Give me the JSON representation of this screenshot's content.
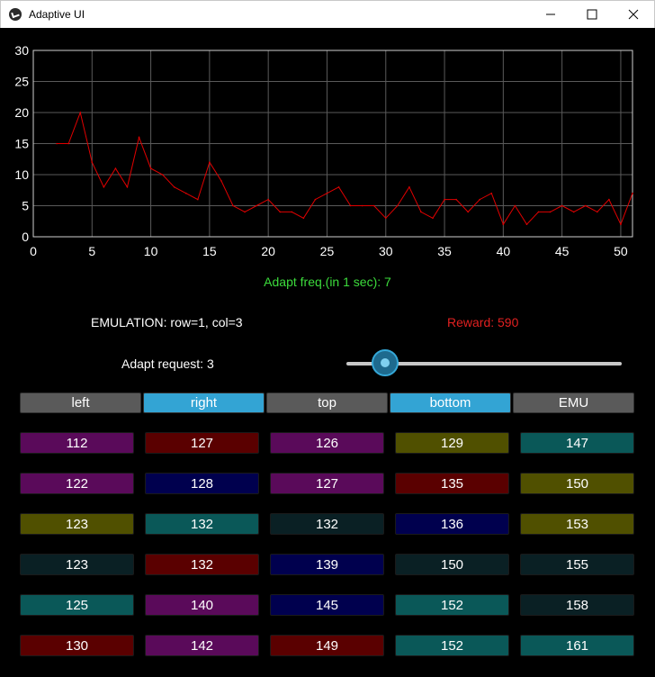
{
  "window": {
    "title": "Adaptive UI"
  },
  "chart_data": {
    "type": "line",
    "title": "",
    "xlabel": "",
    "ylabel": "",
    "xlim": [
      0,
      51
    ],
    "ylim": [
      0,
      30
    ],
    "x_ticks": [
      0,
      5,
      10,
      15,
      20,
      25,
      30,
      35,
      40,
      45,
      50
    ],
    "y_ticks": [
      0,
      5,
      10,
      15,
      20,
      25,
      30
    ],
    "grid": true,
    "series": [
      {
        "color": "#e00000",
        "x": [
          2,
          3,
          4,
          5,
          6,
          7,
          8,
          9,
          10,
          11,
          12,
          13,
          14,
          15,
          16,
          17,
          18,
          19,
          20,
          21,
          22,
          23,
          24,
          25,
          26,
          27,
          28,
          29,
          30,
          31,
          32,
          33,
          34,
          35,
          36,
          37,
          38,
          39,
          40,
          41,
          42,
          43,
          44,
          45,
          46,
          47,
          48,
          49,
          50,
          51
        ],
        "values": [
          15,
          15,
          20,
          12,
          8,
          11,
          8,
          16,
          11,
          10,
          8,
          7,
          6,
          12,
          9,
          5,
          4,
          5,
          6,
          4,
          4,
          3,
          6,
          7,
          8,
          5,
          5,
          5,
          3,
          5,
          8,
          4,
          3,
          6,
          6,
          4,
          6,
          7,
          2,
          5,
          2,
          4,
          4,
          5,
          4,
          5,
          4,
          6,
          2,
          7
        ]
      }
    ]
  },
  "labels": {
    "adapt_freq": "Adapt freq.(in 1 sec): 7",
    "emulation": "EMULATION: row=1, col=3",
    "reward": "Reward: 590",
    "adapt_request": "Adapt request: 3"
  },
  "slider": {
    "value": 3
  },
  "tabs": [
    {
      "label": "left",
      "active": false
    },
    {
      "label": "right",
      "active": true
    },
    {
      "label": "top",
      "active": false
    },
    {
      "label": "bottom",
      "active": true
    },
    {
      "label": "EMU",
      "active": false
    }
  ],
  "colors": {
    "purple": "#5a0a5a",
    "darkred": "#5a0000",
    "olive": "#505000",
    "teal": "#0a5858",
    "navy": "#00004e",
    "darkslate": "#0a2024",
    "tab_off": "#5a5a5a",
    "tab_on": "#33a4d4"
  },
  "grid": [
    [
      {
        "v": "112",
        "c": "purple"
      },
      {
        "v": "127",
        "c": "darkred"
      },
      {
        "v": "126",
        "c": "purple"
      },
      {
        "v": "129",
        "c": "olive"
      },
      {
        "v": "147",
        "c": "teal"
      }
    ],
    [
      {
        "v": "122",
        "c": "purple"
      },
      {
        "v": "128",
        "c": "navy"
      },
      {
        "v": "127",
        "c": "purple"
      },
      {
        "v": "135",
        "c": "darkred"
      },
      {
        "v": "150",
        "c": "olive"
      }
    ],
    [
      {
        "v": "123",
        "c": "olive"
      },
      {
        "v": "132",
        "c": "teal"
      },
      {
        "v": "132",
        "c": "darkslate"
      },
      {
        "v": "136",
        "c": "navy"
      },
      {
        "v": "153",
        "c": "olive"
      }
    ],
    [
      {
        "v": "123",
        "c": "darkslate"
      },
      {
        "v": "132",
        "c": "darkred"
      },
      {
        "v": "139",
        "c": "navy"
      },
      {
        "v": "150",
        "c": "darkslate"
      },
      {
        "v": "155",
        "c": "darkslate"
      }
    ],
    [
      {
        "v": "125",
        "c": "teal"
      },
      {
        "v": "140",
        "c": "purple"
      },
      {
        "v": "145",
        "c": "navy"
      },
      {
        "v": "152",
        "c": "teal"
      },
      {
        "v": "158",
        "c": "darkslate"
      }
    ],
    [
      {
        "v": "130",
        "c": "darkred"
      },
      {
        "v": "142",
        "c": "purple"
      },
      {
        "v": "149",
        "c": "darkred"
      },
      {
        "v": "152",
        "c": "teal"
      },
      {
        "v": "161",
        "c": "teal"
      }
    ]
  ]
}
